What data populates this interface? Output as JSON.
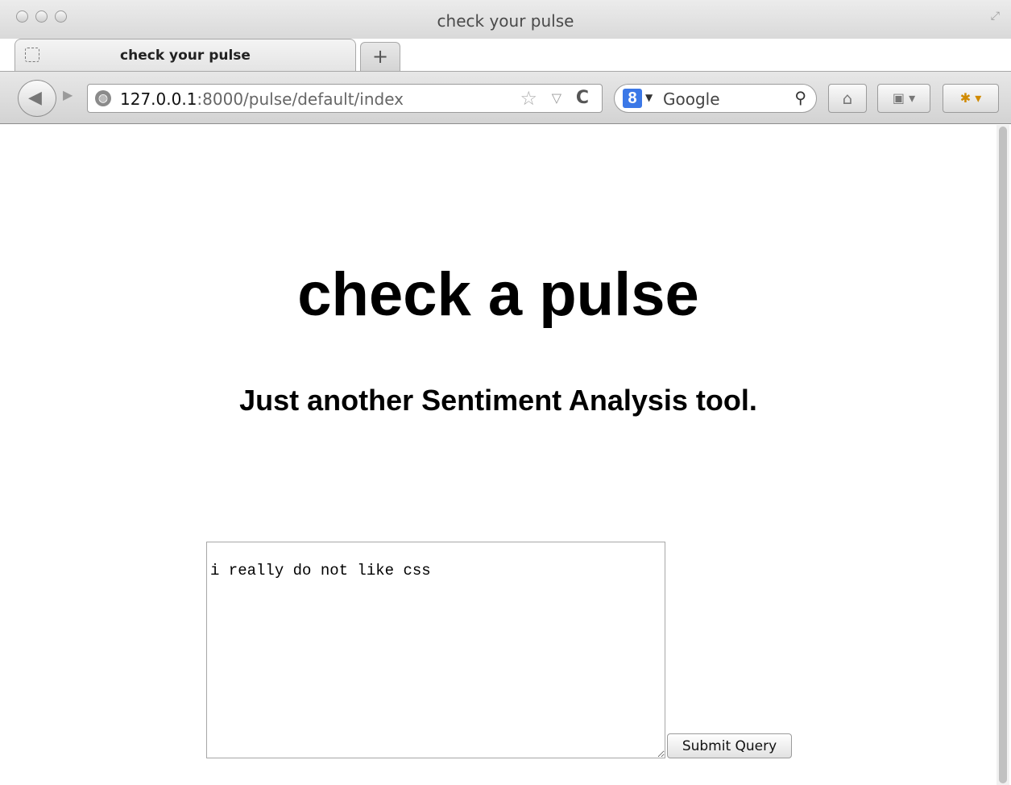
{
  "window": {
    "title": "check your pulse"
  },
  "tabs": [
    {
      "label": "check your pulse"
    }
  ],
  "newtab_label": "+",
  "navbar": {
    "url_host": "127.0.0.1",
    "url_rest": ":8000/pulse/default/index",
    "search_engine_label": "Google",
    "search_engine_badge": "8"
  },
  "page": {
    "heading": "check a pulse",
    "subheading": "Just another Sentiment Analysis tool.",
    "query_text": "i really do not like css",
    "submit_label": "Submit Query"
  },
  "icons": {
    "back": "back-arrow-icon",
    "forward": "forward-arrow-icon",
    "globe": "globe-icon",
    "bookmark_star": "star-icon",
    "reload": "reload-icon",
    "search": "magnifier-icon",
    "home": "home-icon",
    "bookmarks": "bookmarks-icon",
    "addon": "addon-icon"
  }
}
